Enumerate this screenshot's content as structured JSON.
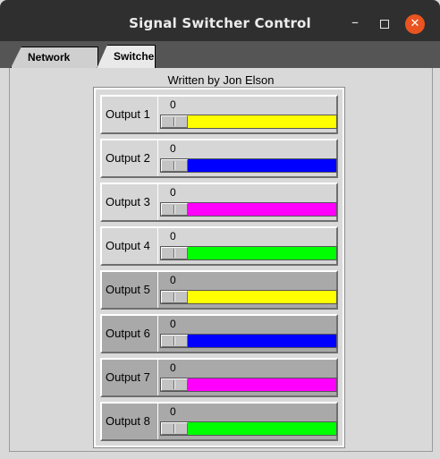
{
  "window": {
    "title": "Signal Switcher Control"
  },
  "tabs": [
    {
      "label": "Network Setup"
    },
    {
      "label": "Switcher"
    }
  ],
  "author": "Written by Jon Elson",
  "outputs": [
    {
      "label": "Output 1",
      "value": "0",
      "color": "#ffff00"
    },
    {
      "label": "Output 2",
      "value": "0",
      "color": "#0000ff"
    },
    {
      "label": "Output 3",
      "value": "0",
      "color": "#ff00ff"
    },
    {
      "label": "Output 4",
      "value": "0",
      "color": "#00ff00"
    },
    {
      "label": "Output 5",
      "value": "0",
      "color": "#ffff00"
    },
    {
      "label": "Output 6",
      "value": "0",
      "color": "#0000ff"
    },
    {
      "label": "Output 7",
      "value": "0",
      "color": "#ff00ff"
    },
    {
      "label": "Output 8",
      "value": "0",
      "color": "#00ff00"
    }
  ]
}
